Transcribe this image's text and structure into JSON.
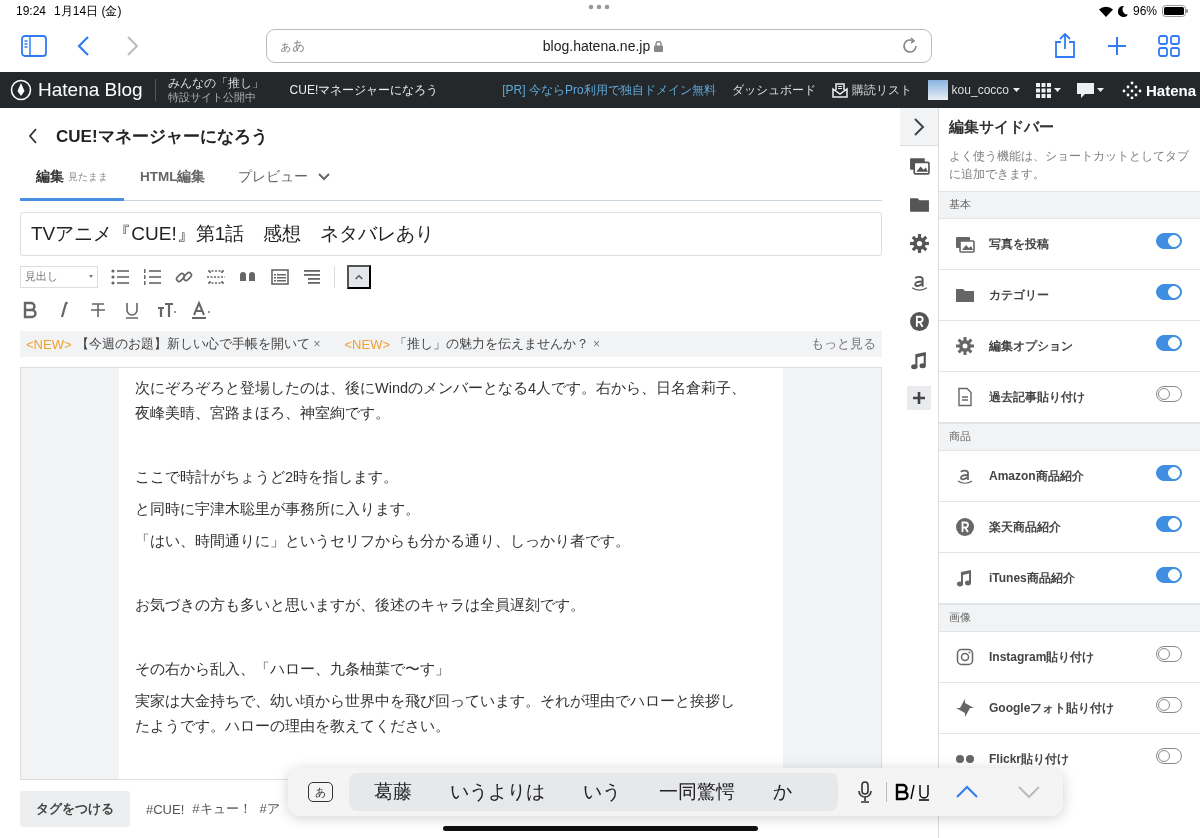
{
  "status_bar": {
    "time": "19:24",
    "date": "1月14日 (金)",
    "battery": "96%"
  },
  "browser": {
    "address_placeholder": "ぁあ",
    "url": "blog.hatena.ne.jp"
  },
  "blog_nav": {
    "logo": "Hatena Blog",
    "promo_title": "みんなの「推し」",
    "promo_sub": "特設サイト公開中",
    "blog_menu": "CUE!マネージャーになろう",
    "pr_link": "[PR] 今ならPro利用で独自ドメイン無料",
    "dashboard": "ダッシュボード",
    "reading_list": "購読リスト",
    "user": "kou_cocco",
    "hatena": "Hatena"
  },
  "editor": {
    "blog_title": "CUE!マネージャーになろう",
    "tabs": [
      {
        "label": "編集",
        "sub": "見たまま",
        "selected": true
      },
      {
        "label": "HTML編集",
        "selected": false
      },
      {
        "label": "プレビュー",
        "selected": false
      }
    ],
    "entry_title": "TVアニメ『CUE!』第1話　感想　ネタバレあり",
    "heading_select": "見出し",
    "notices": [
      {
        "badge": "<NEW>",
        "text": "【今週のお題】新しい心で手帳を開いて",
        "close": "×"
      },
      {
        "badge": "<NEW>",
        "text": "「推し」の魅力を伝えませんか？",
        "close": "×"
      }
    ],
    "more": "もっと見る",
    "paragraphs": [
      {
        "text": "次にぞろぞろと登場したのは、後にWindのメンバーとなる4人です。右から、日名倉莉子、夜峰美晴、宮路まほろ、神室絢です。",
        "gap_before": false
      },
      {
        "text": "ここで時計がちょうど2時を指します。",
        "gap_before": true
      },
      {
        "text": "と同時に宇津木聡里が事務所に入ります。",
        "gap_before": false
      },
      {
        "text": "「はい、時間通りに」というセリフからも分かる通り、しっかり者です。",
        "gap_before": false
      },
      {
        "text": "お気づきの方も多いと思いますが、後述のキャラは全員遅刻です。",
        "gap_before": true
      },
      {
        "text": "その右から乱入、「ハロー、九条柚葉で〜す」",
        "gap_before": true
      },
      {
        "text": "実家は大金持ちで、幼い頃から世界中を飛び回っています。それが理由でハローと挨拶したようです。ハローの理由を教えてください。",
        "gap_before": false
      }
    ],
    "tag_button": "タグをつける",
    "tags": [
      "#CUE!",
      "#キュー！",
      "#ア"
    ]
  },
  "sidebar": {
    "title": "編集サイドバー",
    "description": "よく使う機能は、ショートカットとしてタブに追加できます。",
    "sections": [
      {
        "name": "基本",
        "items": [
          {
            "label": "写真を投稿",
            "kind": "photo",
            "on": true
          },
          {
            "label": "カテゴリー",
            "kind": "folder",
            "on": true
          },
          {
            "label": "編集オプション",
            "kind": "gear",
            "on": true
          },
          {
            "label": "過去記事貼り付け",
            "kind": "document",
            "on": false
          }
        ]
      },
      {
        "name": "商品",
        "items": [
          {
            "label": "Amazon商品紹介",
            "kind": "amazon",
            "on": true
          },
          {
            "label": "楽天商品紹介",
            "kind": "rakuten",
            "on": true
          },
          {
            "label": "iTunes商品紹介",
            "kind": "music",
            "on": true
          }
        ]
      },
      {
        "name": "画像",
        "items": [
          {
            "label": "Instagram貼り付け",
            "kind": "instagram",
            "on": false
          },
          {
            "label": "Googleフォト貼り付け",
            "kind": "pinwheel",
            "on": false
          },
          {
            "label": "Flickr貼り付け",
            "kind": "dots",
            "on": false
          }
        ]
      }
    ]
  },
  "keyboard_bar": {
    "mode_key": "あ",
    "candidates": [
      "葛藤",
      "いうよりは",
      "いう",
      "一同驚愕",
      "か"
    ]
  }
}
